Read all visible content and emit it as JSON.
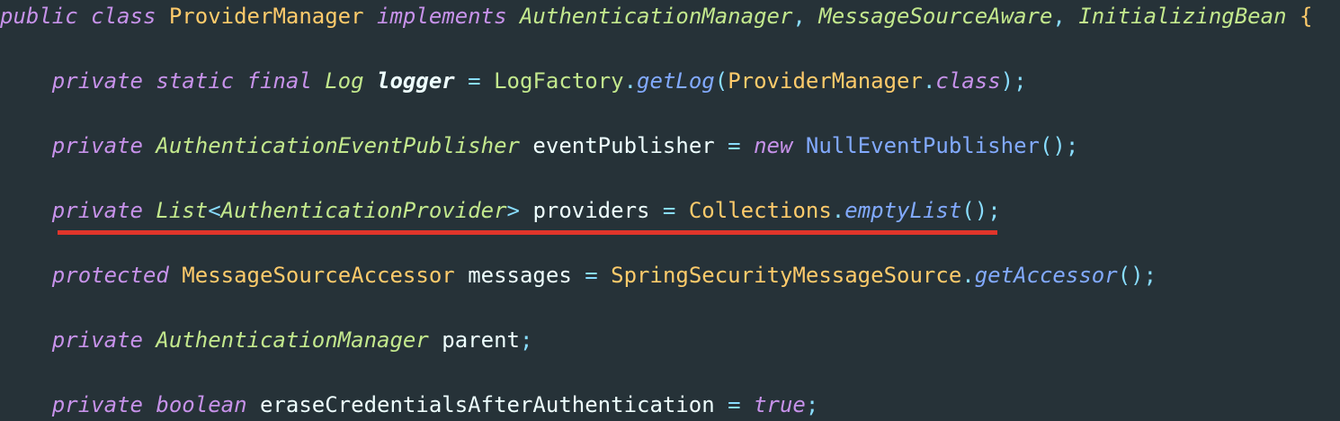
{
  "colors": {
    "background": "#263238",
    "keyword": "#c792ea",
    "type": "#c3e88d",
    "class_ref": "#ffcb6b",
    "method": "#82aaff",
    "punctuation": "#89ddff",
    "identifier": "#eeffff",
    "underline": "#e0352b"
  },
  "editor": {
    "lines": [
      [
        {
          "text": "public class ",
          "style": "keyword"
        },
        {
          "text": "ProviderManager ",
          "style": "class_ref"
        },
        {
          "text": "implements ",
          "style": "keyword"
        },
        {
          "text": "AuthenticationManager",
          "style": "type"
        },
        {
          "text": ", ",
          "style": "punctuation"
        },
        {
          "text": "MessageSourceAware",
          "style": "type"
        },
        {
          "text": ", ",
          "style": "punctuation"
        },
        {
          "text": "InitializingBean ",
          "style": "type"
        },
        {
          "text": "{",
          "style": "class_ref"
        }
      ],
      [
        {
          "text": "    private static final ",
          "style": "keyword"
        },
        {
          "text": "Log ",
          "style": "type"
        },
        {
          "text": "logger",
          "style": "identifier_bold"
        },
        {
          "text": " = ",
          "style": "punctuation"
        },
        {
          "text": "LogFactory",
          "style": "type_plain"
        },
        {
          "text": ".",
          "style": "punctuation"
        },
        {
          "text": "getLog",
          "style": "method"
        },
        {
          "text": "(",
          "style": "punctuation"
        },
        {
          "text": "ProviderManager",
          "style": "class_ref"
        },
        {
          "text": ".",
          "style": "punctuation"
        },
        {
          "text": "class",
          "style": "keyword"
        },
        {
          "text": ");",
          "style": "punctuation"
        }
      ],
      [
        {
          "text": "    private ",
          "style": "keyword"
        },
        {
          "text": "AuthenticationEventPublisher ",
          "style": "type"
        },
        {
          "text": "eventPublisher",
          "style": "identifier"
        },
        {
          "text": " = ",
          "style": "punctuation"
        },
        {
          "text": "new ",
          "style": "keyword"
        },
        {
          "text": "NullEventPublisher",
          "style": "method_plain"
        },
        {
          "text": "();",
          "style": "punctuation"
        }
      ],
      [
        {
          "text": "    private ",
          "style": "keyword"
        },
        {
          "text": "List",
          "style": "type"
        },
        {
          "text": "<",
          "style": "punctuation"
        },
        {
          "text": "AuthenticationProvider",
          "style": "type"
        },
        {
          "text": "> ",
          "style": "punctuation"
        },
        {
          "text": "providers",
          "style": "identifier"
        },
        {
          "text": " = ",
          "style": "punctuation"
        },
        {
          "text": "Collections",
          "style": "class_plain"
        },
        {
          "text": ".",
          "style": "punctuation"
        },
        {
          "text": "emptyList",
          "style": "method"
        },
        {
          "text": "();",
          "style": "punctuation"
        }
      ],
      [
        {
          "text": "    protected ",
          "style": "keyword"
        },
        {
          "text": "MessageSourceAccessor ",
          "style": "class_plain"
        },
        {
          "text": "messages",
          "style": "identifier"
        },
        {
          "text": " = ",
          "style": "punctuation"
        },
        {
          "text": "SpringSecurityMessageSource",
          "style": "class_plain"
        },
        {
          "text": ".",
          "style": "punctuation"
        },
        {
          "text": "getAccessor",
          "style": "method"
        },
        {
          "text": "();",
          "style": "punctuation"
        }
      ],
      [
        {
          "text": "    private ",
          "style": "keyword"
        },
        {
          "text": "AuthenticationManager ",
          "style": "type"
        },
        {
          "text": "parent",
          "style": "identifier"
        },
        {
          "text": ";",
          "style": "punctuation"
        }
      ],
      [
        {
          "text": "    private ",
          "style": "keyword"
        },
        {
          "text": "boolean ",
          "style": "keyword"
        },
        {
          "text": "eraseCredentialsAfterAuthentication",
          "style": "identifier"
        },
        {
          "text": " = ",
          "style": "punctuation"
        },
        {
          "text": "true",
          "style": "keyword"
        },
        {
          "text": ";",
          "style": "punctuation"
        }
      ]
    ]
  }
}
